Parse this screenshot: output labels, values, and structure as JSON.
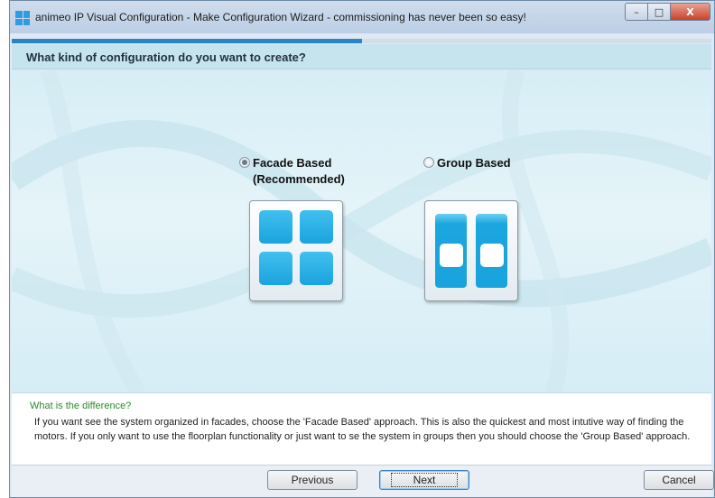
{
  "window": {
    "title": "animeo IP Visual Configuration - Make Configuration Wizard - commissioning has never been so easy!",
    "controls": {
      "minimize": "–",
      "maximize": "□",
      "close": "X"
    }
  },
  "wizard": {
    "progress_fraction": 0.5,
    "question": "What kind of configuration do you want to create?"
  },
  "options": [
    {
      "label_line1": "Facade Based",
      "label_line2": "(Recommended)",
      "selected": true,
      "icon": "facade-grid-icon"
    },
    {
      "label_line1": "Group Based",
      "label_line2": "",
      "selected": false,
      "icon": "group-columns-icon"
    }
  ],
  "info": {
    "title": "What is the difference?",
    "body": "If you want see the system organized in facades, choose the 'Facade Based' approach. This is also the quickest and most intutive way of finding the motors. If you only want to use the floorplan functionality or just want to se the system in groups then you should choose the 'Group Based' approach."
  },
  "buttons": {
    "previous": "Previous",
    "next": "Next",
    "cancel": "Cancel"
  },
  "colors": {
    "accent": "#2a84c6",
    "tile_blue": "#1aa3de",
    "info_title": "#2d8a2d"
  }
}
